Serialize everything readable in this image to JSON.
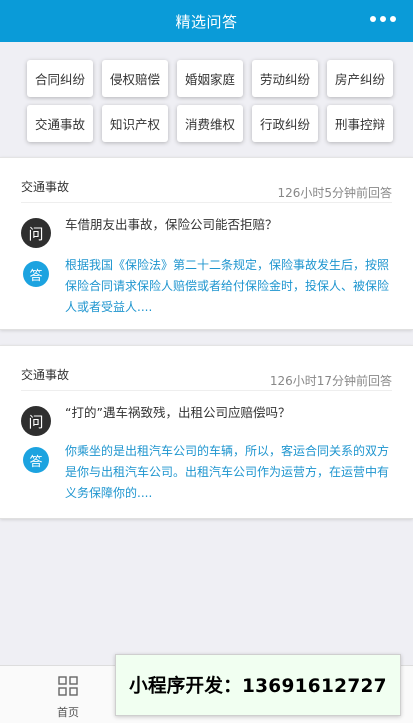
{
  "header": {
    "title": "精选问答",
    "more_icon": "more-dots-icon"
  },
  "categories": [
    "合同纠纷",
    "侵权赔偿",
    "婚姻家庭",
    "劳动纠纷",
    "房产纠纷",
    "交通事故",
    "知识产权",
    "消费维权",
    "行政纠纷",
    "刑事控辩"
  ],
  "cards": [
    {
      "category": "交通事故",
      "time": "126小时5分钟前回答",
      "q_badge": "问",
      "question": "车借朋友出事故，保险公司能否拒赔？",
      "a_badge": "答",
      "answer": "根据我国《保险法》第二十二条规定，保险事故发生后，按照保险合同请求保险人赔偿或者给付保险金时，投保人、被保险人或者受益人...."
    },
    {
      "category": "交通事故",
      "time": "126小时17分钟前回答",
      "q_badge": "问",
      "question": "“打的”遇车祸致残，出租公司应赔偿吗？",
      "a_badge": "答",
      "answer": "你乘坐的是出租汽车公司的车辆，所以，客运合同关系的双方是你与出租汽车公司。出租汽车公司作为运营方，在运营中有义务保障你的...."
    }
  ],
  "tabbar": {
    "home_label": "首页",
    "home_icon": "grid-icon"
  },
  "ad": {
    "text": "小程序开发：13691612727"
  },
  "colors": {
    "header_bg": "#0a9bd8",
    "answer_text": "#1e95cf",
    "a_badge_bg": "#1ca3e0",
    "q_badge_bg": "#2f2f2f"
  }
}
